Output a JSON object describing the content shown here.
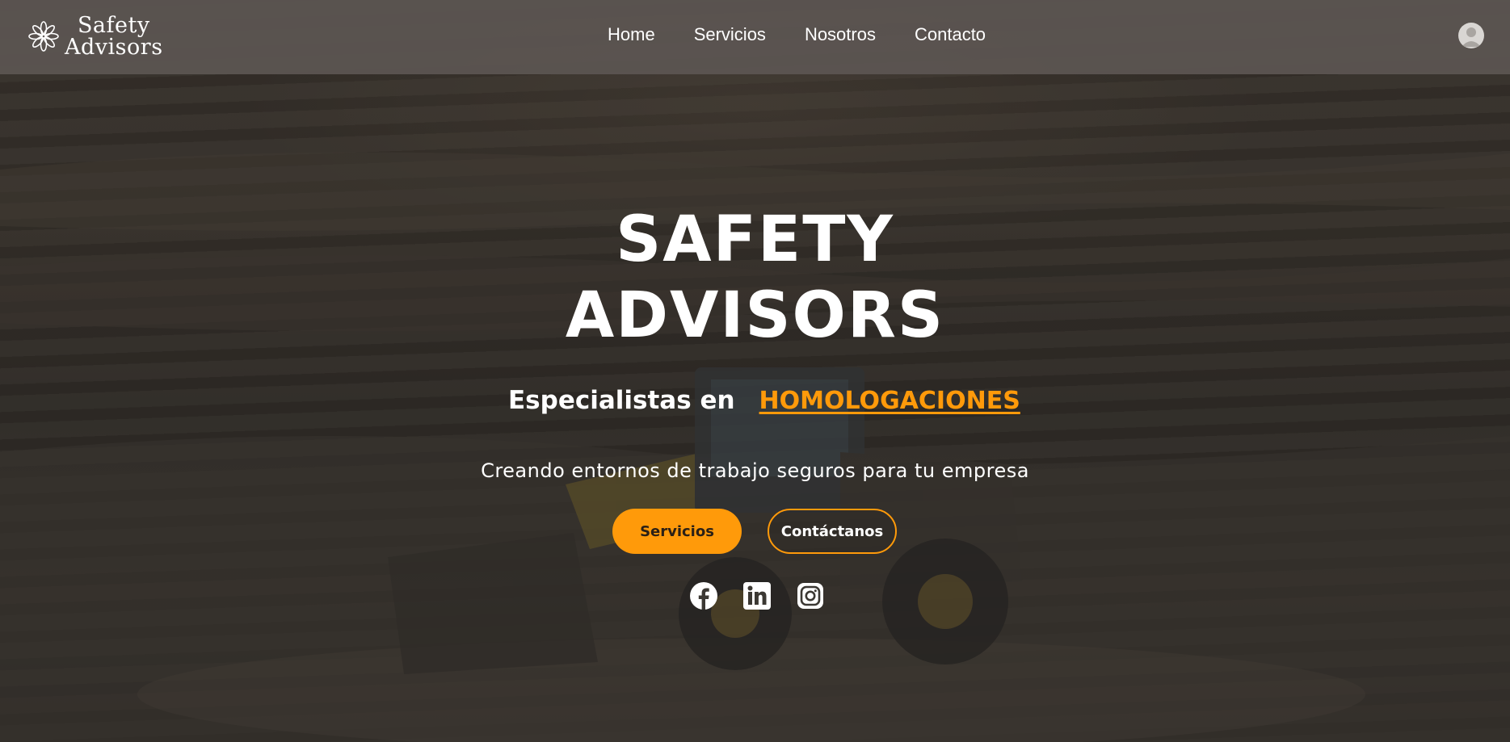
{
  "header": {
    "logo": {
      "line1": "Safety",
      "line2": "Advisors"
    },
    "nav": [
      "Home",
      "Servicios",
      "Nosotros",
      "Contacto"
    ],
    "avatar_icon": "user-avatar-icon"
  },
  "hero": {
    "title_line1": "SAFETY",
    "title_line2": "ADVISORS",
    "tagline_static": "Especialistas en",
    "tagline_highlight": "HOMOLOGACIONES",
    "subtitle": "Creando entornos de trabajo seguros para tu empresa",
    "primary_button": "Servicios",
    "secondary_button": "Contáctanos",
    "socials": [
      "facebook-icon",
      "linkedin-icon",
      "instagram-icon"
    ]
  },
  "colors": {
    "accent": "#ff9a0a",
    "header_bg": "#5c5652",
    "text": "#ffffff"
  }
}
